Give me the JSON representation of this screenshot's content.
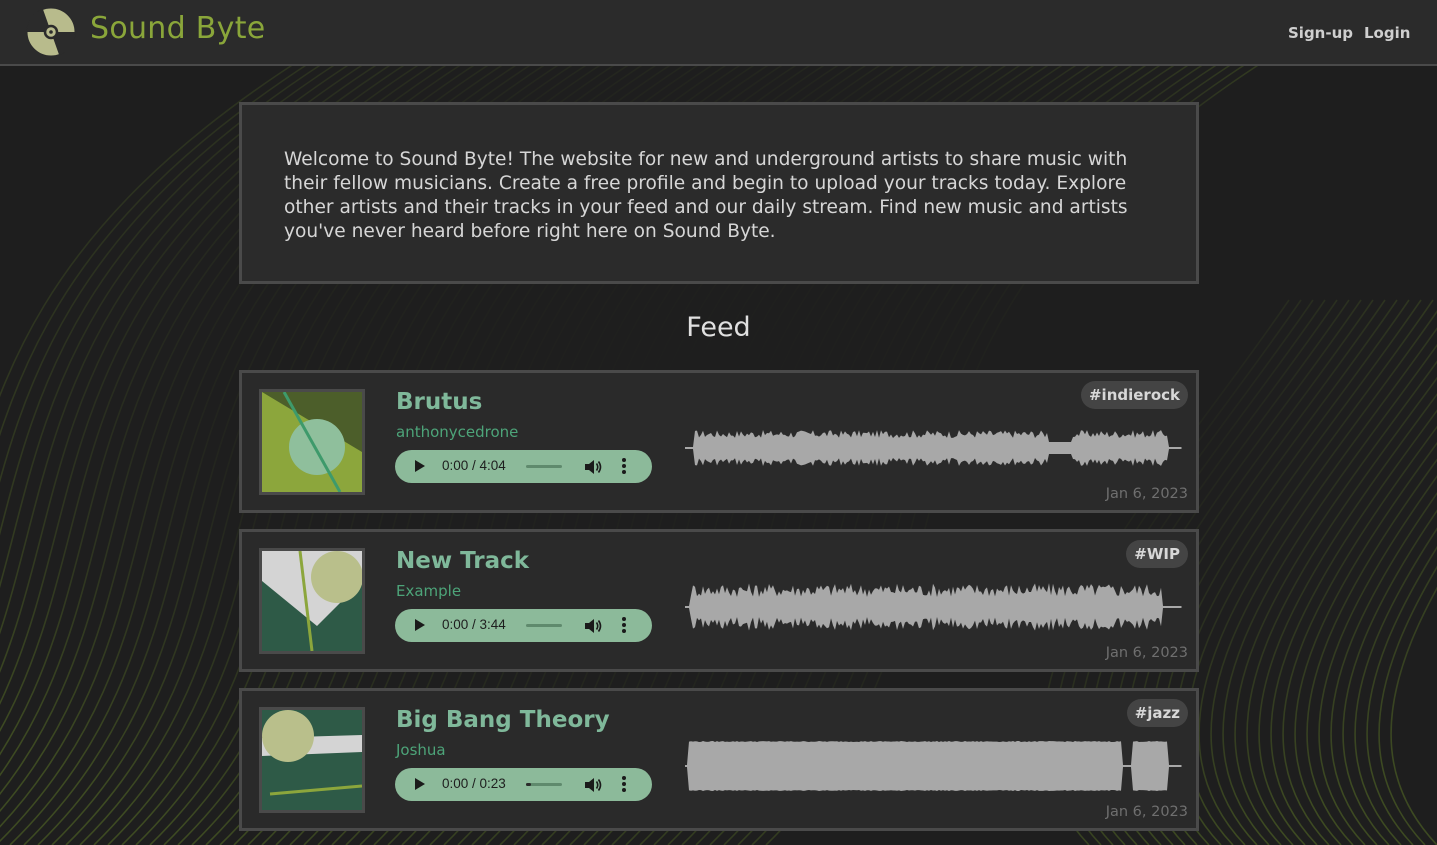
{
  "nav": {
    "brand": "Sound Byte",
    "signup": "Sign-up",
    "login": "Login"
  },
  "welcome": {
    "text": "Welcome to Sound Byte! The website for new and underground artists to share music with their fellow musicians. Create a free profile and begin to upload your tracks today. Explore other artists and their tracks in your feed and our daily stream. Find new music and artists you've never heard before right here on Sound Byte."
  },
  "feed": {
    "title": "Feed",
    "tracks": [
      {
        "title": "Brutus",
        "artist": "anthonycedrone",
        "time": "0:00 / 4:04",
        "progress": 0.0,
        "tag": "#indierock",
        "date": "Jan 6, 2023"
      },
      {
        "title": "New Track",
        "artist": "Example",
        "time": "0:00 / 3:44",
        "progress": 0.0,
        "tag": "#WIP",
        "date": "Jan 6, 2023"
      },
      {
        "title": "Big Bang Theory",
        "artist": "Joshua",
        "time": "0:00 / 0:23",
        "progress": 0.15,
        "tag": "#jazz",
        "date": "Jan 6, 2023"
      }
    ]
  },
  "colors": {
    "brand": "#8aa63a",
    "accent_green": "#7fb89a",
    "player_bg": "#8cba9a",
    "waveform": "#a8a8a8"
  },
  "icons": [
    "disc-icon",
    "play-icon",
    "volume-icon",
    "more-vertical-icon"
  ]
}
